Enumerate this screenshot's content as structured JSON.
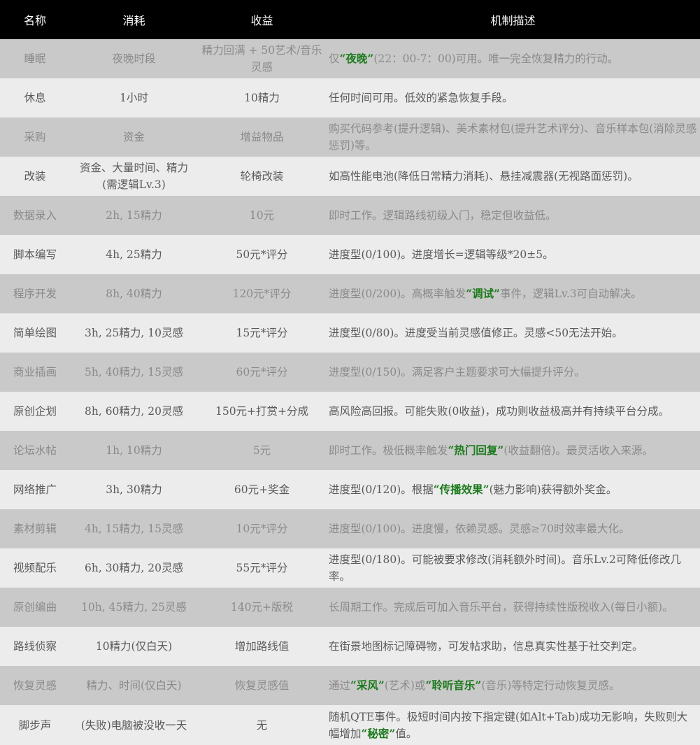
{
  "header": {
    "name": "名称",
    "cost": "消耗",
    "gain": "收益",
    "desc": "机制描述"
  },
  "rows": [
    {
      "name": "睡眠",
      "cost": "夜晚时段",
      "gain": "精力回满 + 50艺术/音乐灵感",
      "desc": [
        {
          "t": "仅"
        },
        {
          "t": "“夜晚”",
          "hl": true
        },
        {
          "t": "(22：00-7：00)可用。唯一完全恢复精力的行动。"
        }
      ]
    },
    {
      "name": "休息",
      "cost": "1小时",
      "gain": "10精力",
      "desc": [
        {
          "t": "任何时间可用。低效的紧急恢复手段。"
        }
      ]
    },
    {
      "name": "采购",
      "cost": "资金",
      "gain": "增益物品",
      "desc": [
        {
          "t": "购买代码参考(提升逻辑)、美术素材包(提升艺术评分)、音乐样本包(消除灵感惩罚)等。"
        }
      ]
    },
    {
      "name": "改装",
      "cost": "资金、大量时间、精力(需逻辑Lv.3)",
      "gain": "轮椅改装",
      "desc": [
        {
          "t": "如高性能电池(降低日常精力消耗)、悬挂减震器(无视路面惩罚)。"
        }
      ]
    },
    {
      "name": "数据录入",
      "cost": "2h, 15精力",
      "gain": "10元",
      "desc": [
        {
          "t": "即时工作。逻辑路线初级入门，稳定但收益低。"
        }
      ]
    },
    {
      "name": "脚本编写",
      "cost": "4h, 25精力",
      "gain": "50元*评分",
      "desc": [
        {
          "t": "进度型(0/100)。进度增长=逻辑等级*20±5。"
        }
      ]
    },
    {
      "name": "程序开发",
      "cost": "8h, 40精力",
      "gain": "120元*评分",
      "desc": [
        {
          "t": "进度型(0/200)。高概率触发"
        },
        {
          "t": "“调试”",
          "hl": true
        },
        {
          "t": "事件，逻辑Lv.3可自动解决。"
        }
      ]
    },
    {
      "name": "简单绘图",
      "cost": "3h, 25精力, 10灵感",
      "gain": "15元*评分",
      "desc": [
        {
          "t": "进度型(0/80)。进度受当前灵感值修正。灵感<50无法开始。"
        }
      ]
    },
    {
      "name": "商业插画",
      "cost": "5h, 40精力, 15灵感",
      "gain": "60元*评分",
      "desc": [
        {
          "t": "进度型(0/150)。满足客户主题要求可大幅提升评分。"
        }
      ]
    },
    {
      "name": "原创企划",
      "cost": "8h, 60精力, 20灵感",
      "gain": "150元+打赏+分成",
      "desc": [
        {
          "t": "高风险高回报。可能失败(0收益)，成功则收益极高并有持续平台分成。"
        }
      ]
    },
    {
      "name": "论坛水帖",
      "cost": "1h, 10精力",
      "gain": "5元",
      "desc": [
        {
          "t": "即时工作。极低概率触发"
        },
        {
          "t": "“热门回复”",
          "hl": true
        },
        {
          "t": "(收益翻倍)。最灵活收入来源。"
        }
      ]
    },
    {
      "name": "网络推广",
      "cost": "3h, 30精力",
      "gain": "60元+奖金",
      "desc": [
        {
          "t": "进度型(0/120)。根据"
        },
        {
          "t": "“传播效果”",
          "hl": true
        },
        {
          "t": "(魅力影响)获得额外奖金。"
        }
      ]
    },
    {
      "name": "素材剪辑",
      "cost": "4h, 15精力, 15灵感",
      "gain": "10元*评分",
      "desc": [
        {
          "t": "进度型(0/100)。进度慢，依赖灵感。灵感≥70时效率最大化。"
        }
      ]
    },
    {
      "name": "视频配乐",
      "cost": "6h, 30精力, 20灵感",
      "gain": "55元*评分",
      "desc": [
        {
          "t": "进度型(0/180)。可能被要求修改(消耗额外时间)。音乐Lv.2可降低修改几率。"
        }
      ]
    },
    {
      "name": "原创编曲",
      "cost": "10h, 45精力, 25灵感",
      "gain": "140元+版税",
      "desc": [
        {
          "t": "长周期工作。完成后可加入音乐平台，获得持续性版税收入(每日小额)。"
        }
      ]
    },
    {
      "name": "路线侦察",
      "cost": "10精力(仅白天)",
      "gain": "增加路线值",
      "desc": [
        {
          "t": "在街景地图标记障碍物，可发帖求助，信息真实性基于社交判定。"
        }
      ]
    },
    {
      "name": "恢复灵感",
      "cost": "精力、时间(仅白天)",
      "gain": "恢复灵感值",
      "desc": [
        {
          "t": "通过"
        },
        {
          "t": "“采风”",
          "hl": true
        },
        {
          "t": "(艺术)或"
        },
        {
          "t": "“聆听音乐”",
          "hl": true
        },
        {
          "t": "(音乐)等特定行动恢复灵感。"
        }
      ]
    },
    {
      "name": "脚步声",
      "cost": "(失败)电脑被没收一天",
      "gain": "无",
      "desc": [
        {
          "t": "随机QTE事件。极短时间内按下指定键(如Alt+Tab)成功无影响，失败则大幅增加"
        },
        {
          "t": "“秘密”",
          "hl": true
        },
        {
          "t": "值。"
        }
      ]
    }
  ]
}
